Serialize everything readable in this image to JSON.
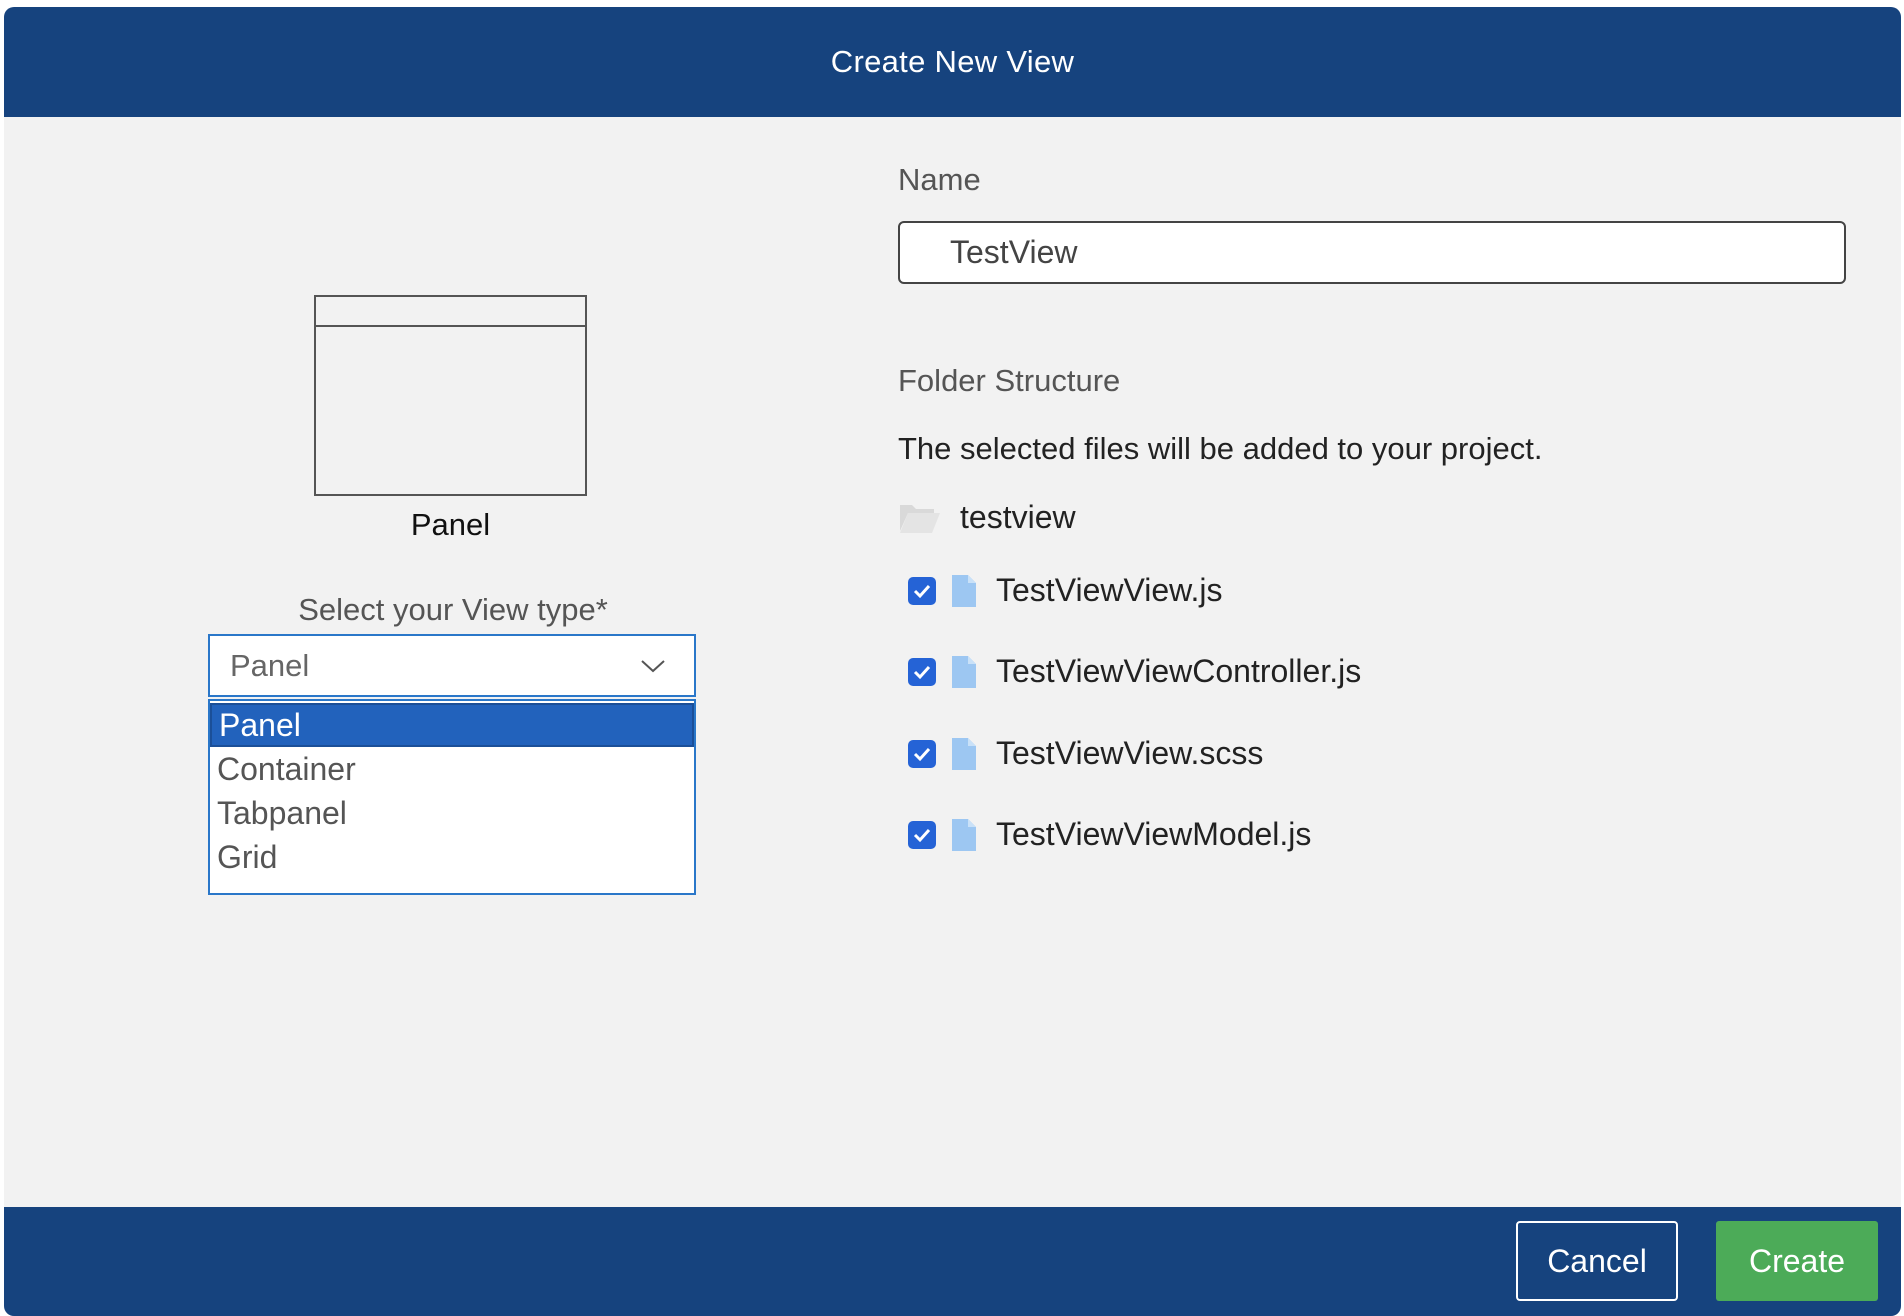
{
  "dialog": {
    "title": "Create New View"
  },
  "preview": {
    "label": "Panel"
  },
  "view_type": {
    "label": "Select your View type*",
    "selected": "Panel",
    "options": [
      "Panel",
      "Container",
      "Tabpanel",
      "Grid"
    ]
  },
  "name": {
    "label": "Name",
    "value": "TestView"
  },
  "folder": {
    "label": "Folder Structure",
    "description": "The selected files will be added to your project.",
    "folder_name": "testview",
    "files": [
      {
        "name": "TestViewView.js",
        "checked": true
      },
      {
        "name": "TestViewViewController.js",
        "checked": true
      },
      {
        "name": "TestViewView.scss",
        "checked": true
      },
      {
        "name": "TestViewViewModel.js",
        "checked": true
      }
    ]
  },
  "footer": {
    "cancel_label": "Cancel",
    "create_label": "Create"
  },
  "colors": {
    "header_bg": "#16437e",
    "create_bg": "#4cab58",
    "accent": "#2262bc",
    "checkbox": "#2563d6"
  }
}
